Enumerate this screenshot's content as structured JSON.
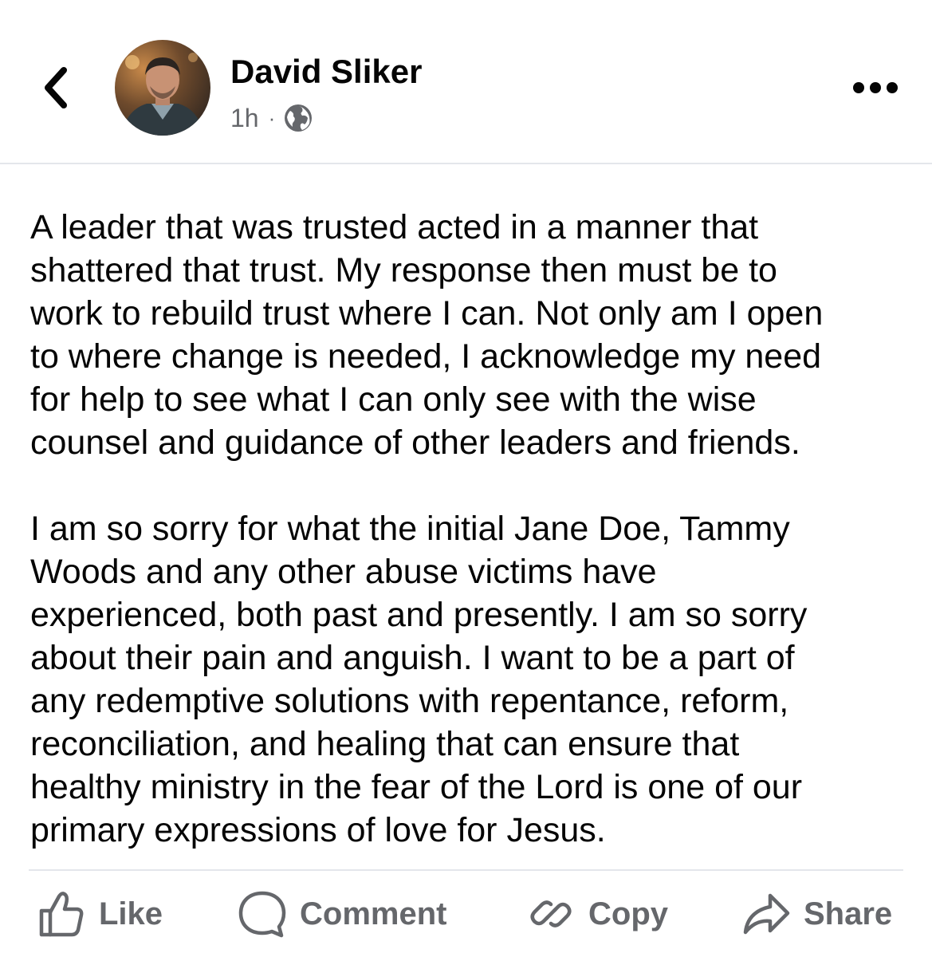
{
  "header": {
    "author_name": "David Sliker",
    "time": "1h",
    "separator": "·",
    "audience_icon": "globe-icon",
    "back_icon": "chevron-left-icon",
    "more_icon": "more-horizontal-icon"
  },
  "post": {
    "paragraphs": [
      "A leader that was trusted acted in a manner that\nshattered that trust. My response then must be to\nwork to rebuild trust where I can. Not only am I open\nto where change is needed, I acknowledge my need\nfor help to see what I can only see with the wise\ncounsel and guidance of other leaders and friends.",
      "I am so sorry for what the initial Jane Doe, Tammy\nWoods and any other abuse victims have\nexperienced, both past and presently. I am so sorry\nabout their pain and anguish. I want to be a part of\nany redemptive solutions with repentance, reform,\nreconciliation, and healing that can ensure that\nhealthy ministry in the fear of the Lord is one of our\nprimary expressions of love for Jesus."
    ]
  },
  "actions": [
    {
      "label": "Like",
      "icon": "thumbs-up-icon"
    },
    {
      "label": "Comment",
      "icon": "comment-bubble-icon"
    },
    {
      "label": "Copy",
      "icon": "link-icon"
    },
    {
      "label": "Share",
      "icon": "share-arrow-icon"
    }
  ],
  "colors": {
    "text_primary": "#050505",
    "text_secondary": "#65676b",
    "divider": "#e4e6eb"
  }
}
